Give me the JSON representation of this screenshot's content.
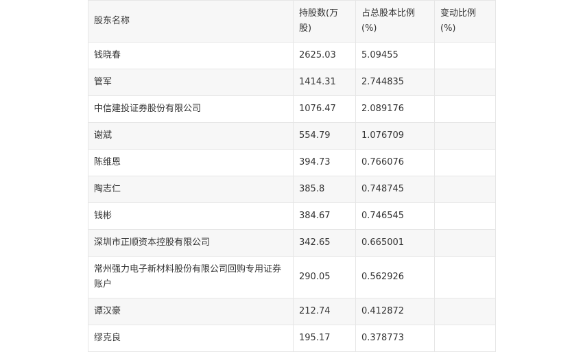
{
  "table": {
    "headers": [
      "股东名称",
      "持股数(万股)",
      "占总股本比例(%)",
      "变动比例(%)"
    ],
    "rows": [
      {
        "name": "钱晓春",
        "shares": "2625.03",
        "ratio": "5.09455",
        "change": ""
      },
      {
        "name": "管军",
        "shares": "1414.31",
        "ratio": "2.744835",
        "change": ""
      },
      {
        "name": "中信建投证券股份有限公司",
        "shares": "1076.47",
        "ratio": "2.089176",
        "change": ""
      },
      {
        "name": "谢斌",
        "shares": "554.79",
        "ratio": "1.076709",
        "change": ""
      },
      {
        "name": "陈维恩",
        "shares": "394.73",
        "ratio": "0.766076",
        "change": ""
      },
      {
        "name": "陶志仁",
        "shares": "385.8",
        "ratio": "0.748745",
        "change": ""
      },
      {
        "name": "钱彬",
        "shares": "384.67",
        "ratio": "0.746545",
        "change": ""
      },
      {
        "name": "深圳市正顺资本控股有限公司",
        "shares": "342.65",
        "ratio": "0.665001",
        "change": ""
      },
      {
        "name": "常州强力电子新材料股份有限公司回购专用证券账户",
        "shares": "290.05",
        "ratio": "0.562926",
        "change": ""
      },
      {
        "name": "谭汉豪",
        "shares": "212.74",
        "ratio": "0.412872",
        "change": ""
      },
      {
        "name": "缪克良",
        "shares": "195.17",
        "ratio": "0.378773",
        "change": ""
      }
    ]
  }
}
